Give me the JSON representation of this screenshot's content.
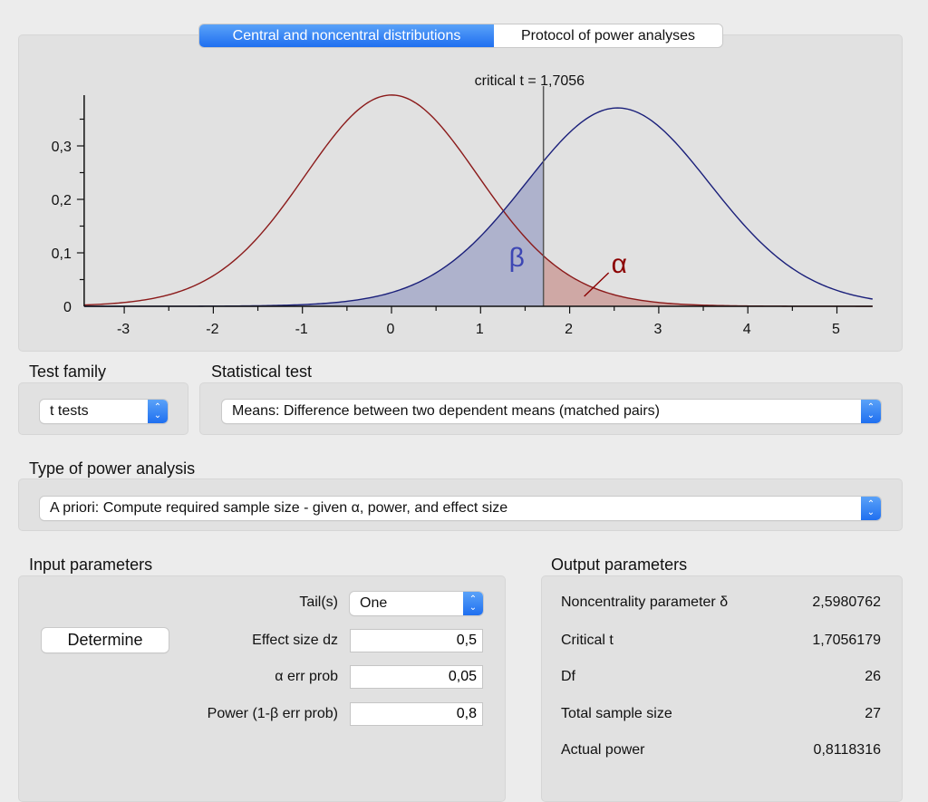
{
  "tabs": [
    {
      "label": "Central and noncentral distributions",
      "active": true
    },
    {
      "label": "Protocol of power analyses",
      "active": false
    }
  ],
  "chart_data": {
    "type": "line",
    "annotation": "critical t = 1,7056",
    "critical_t": 1.7056,
    "noncentrality": 2.5980762,
    "df": 26,
    "xlim": [
      -3.45,
      5.4
    ],
    "ylim": [
      0,
      0.395
    ],
    "x_ticks": [
      "-3",
      "-2",
      "-1",
      "0",
      "1",
      "2",
      "3",
      "4",
      "5"
    ],
    "y_ticks": [
      "0",
      "0,1",
      "0,2",
      "0,3"
    ],
    "x_tick_values": [
      -3,
      -2,
      -1,
      0,
      1,
      2,
      3,
      4,
      5
    ],
    "y_tick_values": [
      0,
      0.1,
      0.2,
      0.3
    ],
    "beta_label": "β",
    "alpha_label": "α",
    "colors": {
      "central": "#8b1a1a",
      "noncentral": "#1a1f7a",
      "beta_fill": "#aeb2cc",
      "alpha_fill": "#cfa8a5",
      "beta_text": "#3c46b4",
      "alpha_text": "#8b0000",
      "critical_line": "#555555"
    },
    "grid": false
  },
  "test_family": {
    "label": "Test family",
    "value": "t tests"
  },
  "statistical_test": {
    "label": "Statistical test",
    "value": "Means: Difference between two dependent means (matched pairs)"
  },
  "power_analysis": {
    "label": "Type of power analysis",
    "value": "A priori: Compute required sample size - given α, power, and effect size"
  },
  "input": {
    "title": "Input parameters",
    "determine_label": "Determine",
    "tails_label": "Tail(s)",
    "tails_value": "One",
    "fields": [
      {
        "label": "Effect size dz",
        "value": "0,5"
      },
      {
        "label": "α err prob",
        "value": "0,05"
      },
      {
        "label": "Power (1-β err prob)",
        "value": "0,8"
      }
    ]
  },
  "output": {
    "title": "Output parameters",
    "rows": [
      {
        "label": "Noncentrality parameter δ",
        "value": "2,5980762"
      },
      {
        "label": "Critical t",
        "value": "1,7056179"
      },
      {
        "label": "Df",
        "value": "26"
      },
      {
        "label": "Total sample size",
        "value": "27"
      },
      {
        "label": "Actual power",
        "value": "0,8118316"
      }
    ]
  },
  "stepper_icon": "up-down-chevron-icon"
}
